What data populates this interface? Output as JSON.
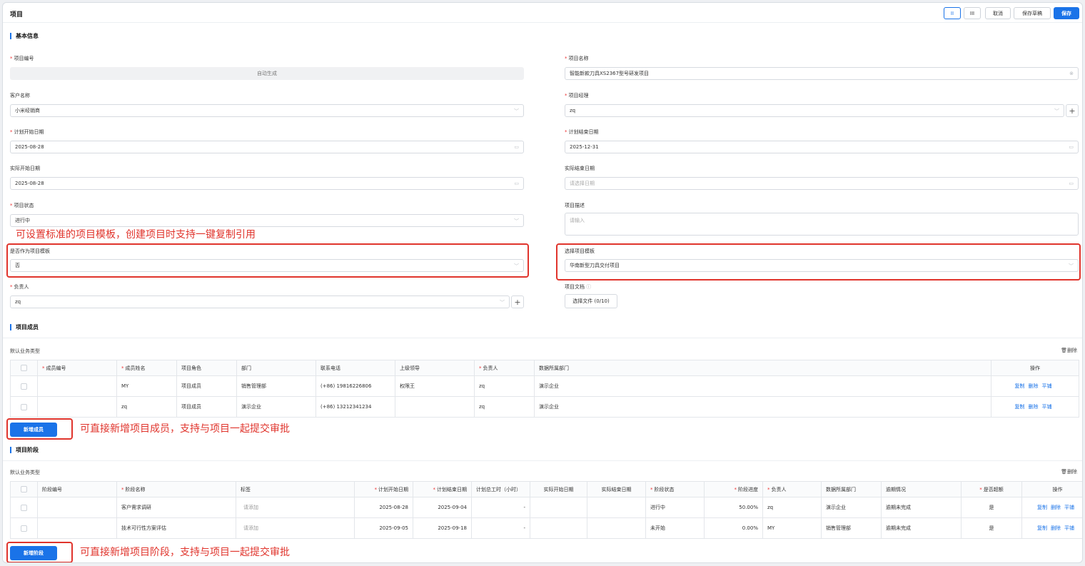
{
  "header": {
    "title": "项目",
    "view_two_col": "II",
    "view_three_col": "III",
    "cancel": "取消",
    "save_draft": "保存草稿",
    "save": "保存"
  },
  "basic": {
    "section_title": "基本信息",
    "project_no": {
      "label": "项目编号",
      "value": "自动生成"
    },
    "project_name": {
      "label": "项目名称",
      "value": "智能新款刀具XS2367型号研发项目"
    },
    "customer": {
      "label": "客户名称",
      "value": "小米经销商"
    },
    "manager": {
      "label": "项目经理",
      "value": "zq"
    },
    "plan_start": {
      "label": "计划开始日期",
      "value": "2025-08-28"
    },
    "plan_end": {
      "label": "计划结束日期",
      "value": "2025-12-31"
    },
    "actual_start": {
      "label": "实际开始日期",
      "value": "2025-08-28"
    },
    "actual_end": {
      "label": "实际结束日期",
      "placeholder": "请选择日期"
    },
    "status": {
      "label": "项目状态",
      "value": "进行中"
    },
    "description": {
      "label": "项目描述",
      "placeholder": "请输入"
    },
    "is_template": {
      "label": "是否作为项目模板",
      "value": "否"
    },
    "select_template": {
      "label": "选择项目模板",
      "value": "华南新型刀具交付项目"
    },
    "owner": {
      "label": "负责人",
      "value": "zq"
    },
    "docs": {
      "label": "项目文档",
      "button": "选择文件 (0/10)"
    }
  },
  "annotations": {
    "template": "可设置标准的项目模板，创建项目时支持一键复制引用",
    "members": "可直接新增项目成员，支持与项目一起提交审批",
    "stages": "可直接新增项目阶段，支持与项目一起提交审批"
  },
  "members": {
    "section_title": "项目成员",
    "biz_type": "默认业务类型",
    "delete_label": "删除",
    "headers": [
      "成员编号",
      "成员姓名",
      "项目角色",
      "部门",
      "联系电话",
      "上级领导",
      "负责人",
      "数据所属部门",
      "操作"
    ],
    "rows": [
      {
        "no": "",
        "name": "MY",
        "role": "项目成员",
        "dept": "销售管理部",
        "phone": "(+86) 19816226806",
        "leader": "权限王",
        "owner": "zq",
        "data_dept": "演示企业"
      },
      {
        "no": "",
        "name": "zq",
        "role": "项目成员",
        "dept": "演示企业",
        "phone": "(+86) 13212341234",
        "leader": "",
        "owner": "zq",
        "data_dept": "演示企业"
      }
    ],
    "actions": {
      "copy": "复制",
      "delete": "删除",
      "flat": "平铺"
    },
    "add_button": "新增成员"
  },
  "stages": {
    "section_title": "项目阶段",
    "biz_type": "默认业务类型",
    "delete_label": "删除",
    "headers": [
      "阶段编号",
      "阶段名称",
      "标签",
      "计划开始日期",
      "计划结束日期",
      "计划总工时（小时）",
      "实际开始日期",
      "实际结束日期",
      "阶段状态",
      "阶段进度",
      "负责人",
      "数据所属部门",
      "逾期情况",
      "是否超额",
      "操作"
    ],
    "rows": [
      {
        "no": "",
        "name": "客户需求调研",
        "tag": "请添加",
        "plan_start": "2025-08-28",
        "plan_end": "2025-09-04",
        "hours": "-",
        "act_start": "",
        "act_end": "",
        "status": "进行中",
        "progress": "50.00%",
        "owner": "zq",
        "data_dept": "演示企业",
        "overdue": "逾期未完成",
        "over": "是"
      },
      {
        "no": "",
        "name": "技术可行性方案评估",
        "tag": "请添加",
        "plan_start": "2025-09-05",
        "plan_end": "2025-09-18",
        "hours": "-",
        "act_start": "",
        "act_end": "",
        "status": "未开始",
        "progress": "0.00%",
        "owner": "MY",
        "data_dept": "销售管理部",
        "overdue": "逾期未完成",
        "over": "是"
      }
    ],
    "actions": {
      "copy": "复制",
      "delete": "删除",
      "flat": "平铺"
    },
    "add_button": "新增阶段"
  }
}
